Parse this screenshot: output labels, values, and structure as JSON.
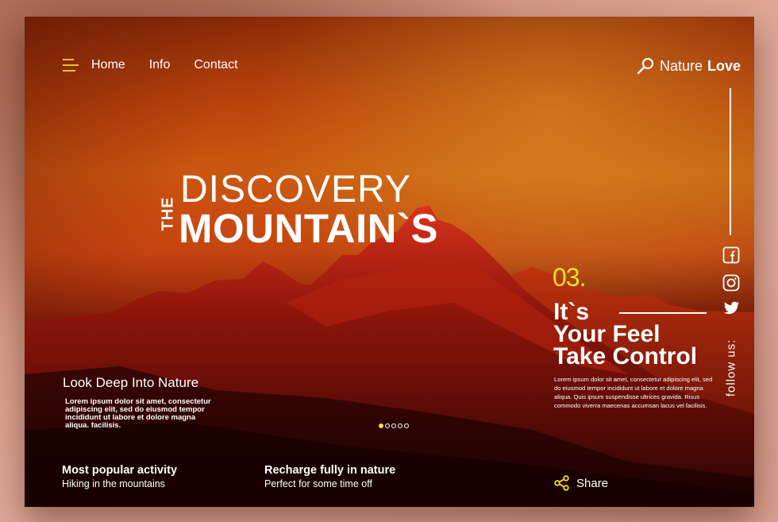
{
  "nav": {
    "items": [
      {
        "label": "Home"
      },
      {
        "label": "Info"
      },
      {
        "label": "Contact"
      }
    ]
  },
  "brand": {
    "first": "Nature",
    "second": "Love",
    "icon": "search-icon"
  },
  "hero": {
    "the": "THE",
    "line1": "DISCOVERY",
    "line2": "MOUNTAIN`S"
  },
  "left": {
    "heading": "Look Deep Into Nature",
    "body": "Lorem ipsum dolor sit amet, consectetur adipiscing elit, sed do eiusmod tempor incididunt ut labore et dolore magna aliqua. facilisis."
  },
  "slider": {
    "count": 5,
    "active_index": 0
  },
  "activities": [
    {
      "title": "Most popular activity",
      "subtitle": "Hiking in the mountains"
    },
    {
      "title": "Recharge fully in nature",
      "subtitle": "Perfect for some time off"
    }
  ],
  "feature": {
    "number": "03.",
    "title_line1": "It`s",
    "title_line2": "Your Feel",
    "title_line3": "Take Control",
    "body": "Lorem ipsum dolor sit amet, consectetur adipiscing elit, sed do eiusmod tempor incididunt ut labore et dolore magna aliqua. Quis ipsum suspendisse ultrices gravida. Risus commodo viverra maecenas accumsan lacus vel facilisis.",
    "share_label": "Share"
  },
  "social": {
    "follow_label": "follow us:",
    "icons": [
      "facebook-icon",
      "instagram-icon",
      "twitter-icon"
    ]
  },
  "colors": {
    "accent_yellow": "#f5df22",
    "text_white": "#ffffff"
  }
}
